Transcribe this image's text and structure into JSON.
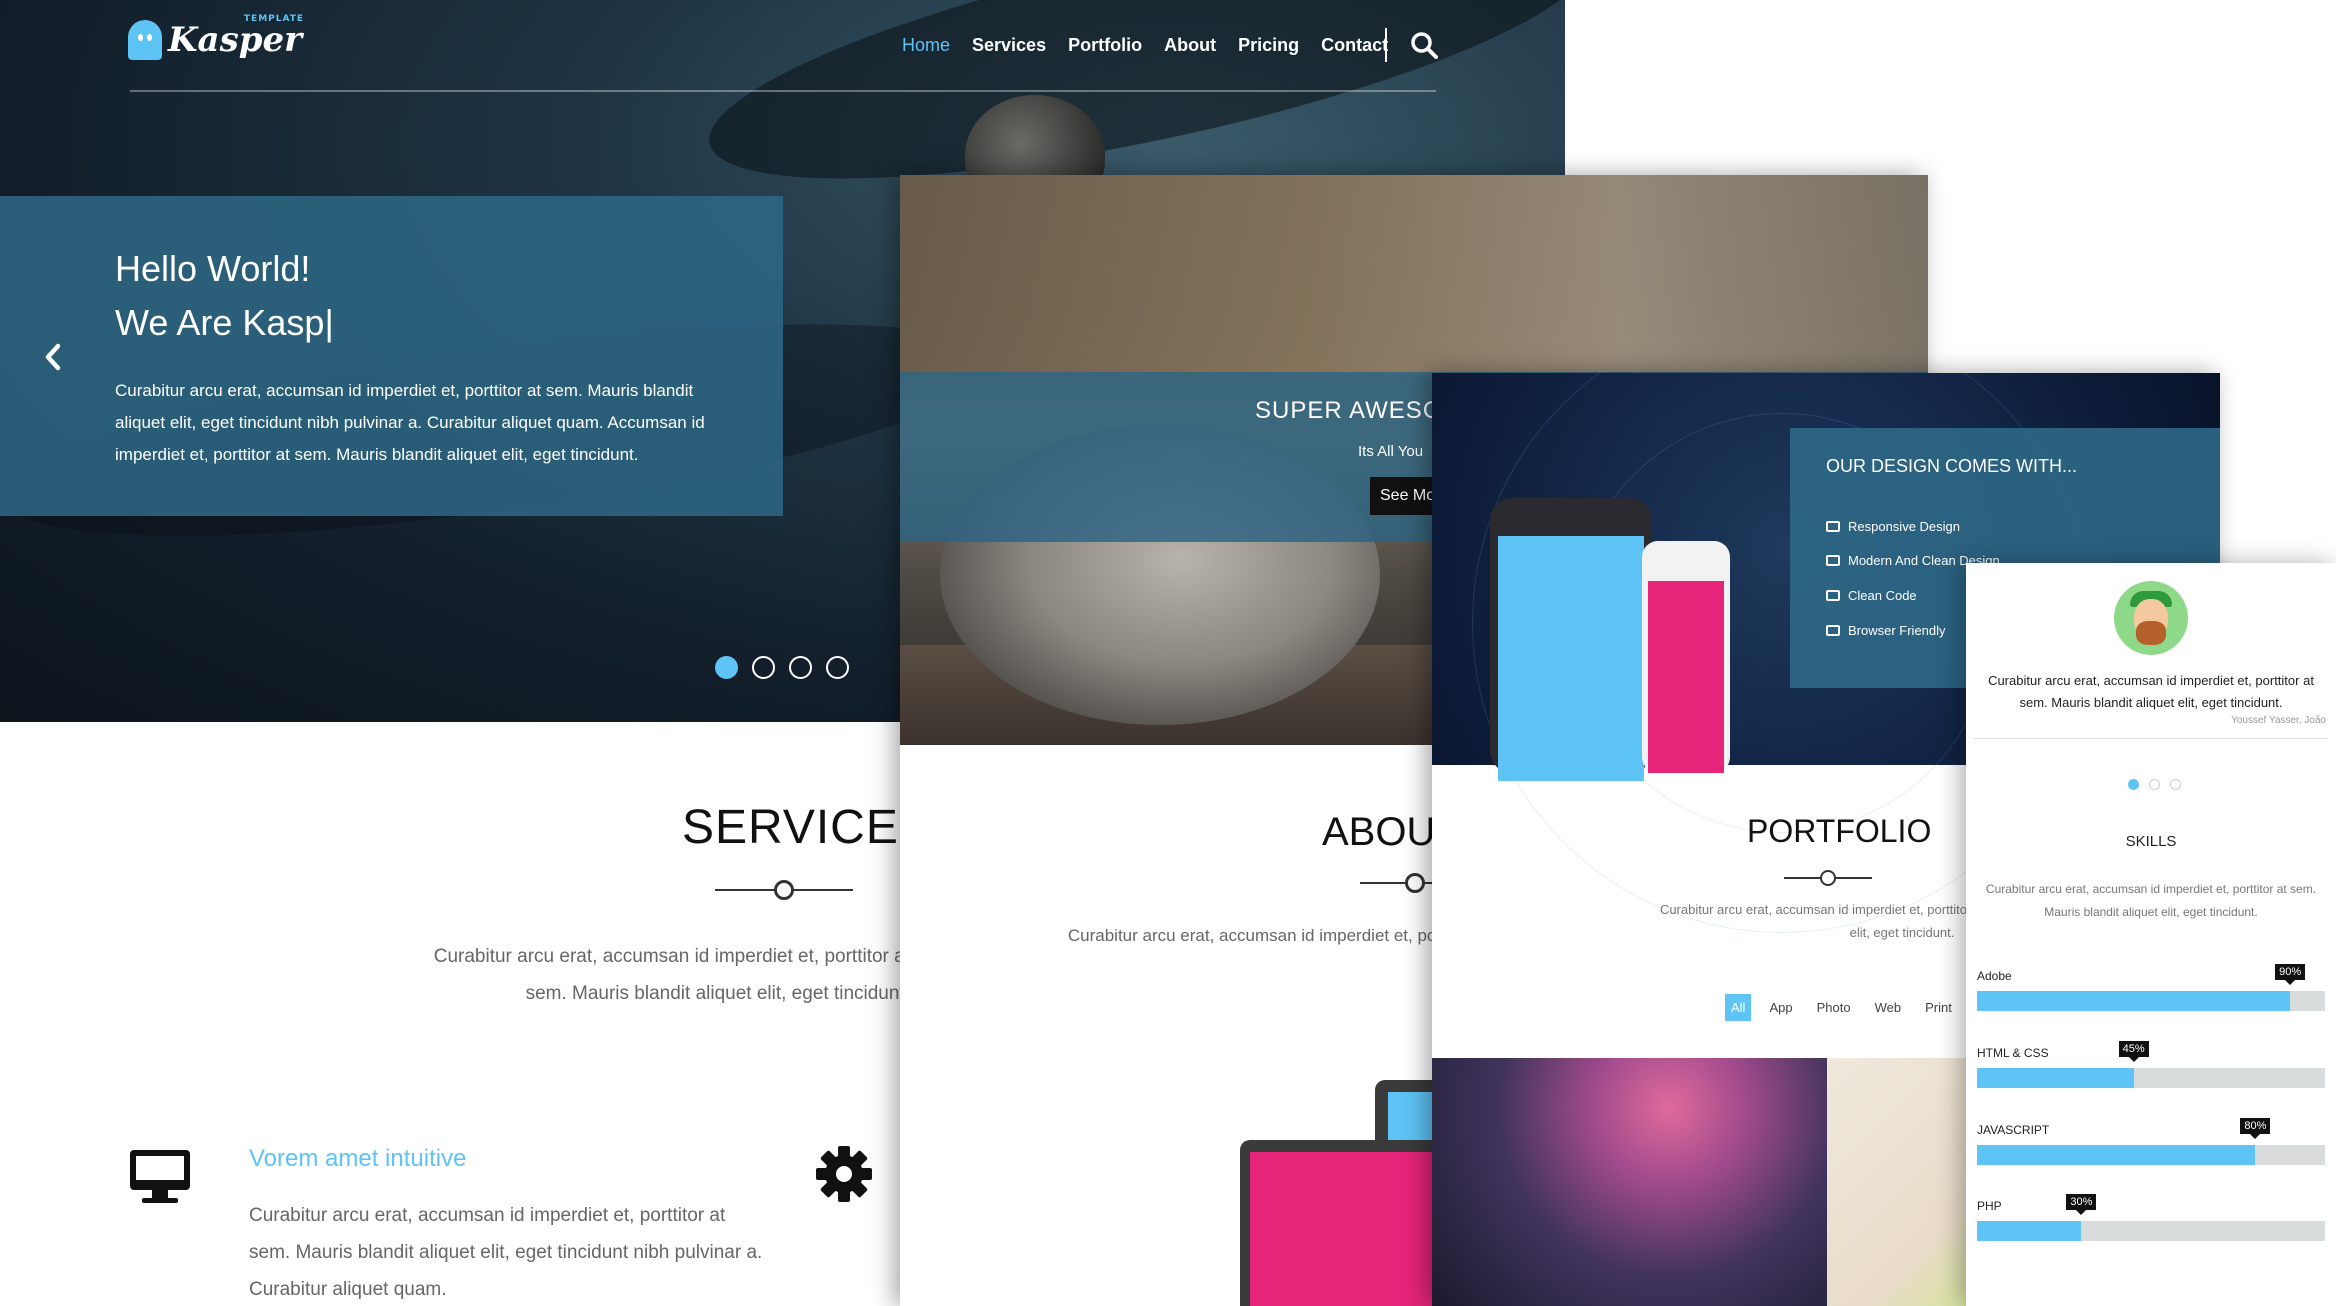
{
  "brand": {
    "logo_name": "Kasper",
    "logo_tag": "TEMPLATE",
    "accent": "#5ec3f5",
    "highlight": "#e5247a"
  },
  "nav": {
    "items": [
      "Home",
      "Services",
      "Portfolio",
      "About",
      "Pricing",
      "Contact"
    ],
    "active": "Home"
  },
  "hero": {
    "line1": "Hello World!",
    "line2": "We Are Kasp|",
    "text": "Curabitur arcu erat, accumsan id imperdiet et, porttitor at sem. Mauris blandit aliquet elit, eget tincidunt nibh pulvinar a. Curabitur aliquet quam. Accumsan id imperdiet et, porttitor at sem. Mauris blandit aliquet elit, eget tincidunt.",
    "slide_count": 4,
    "active_slide": 1
  },
  "services": {
    "title": "SERVICES",
    "text": "Curabitur arcu erat, accumsan id imperdiet et, porttitor at sem. Mauris blandit aliquet elit, eget tincidunt.",
    "feature_title": "Vorem amet intuitive",
    "feature_text": "Curabitur arcu erat, accumsan id imperdiet et, porttitor at sem. Mauris blandit aliquet elit, eget tincidunt nibh pulvinar a. Curabitur aliquet quam."
  },
  "awesome": {
    "heading": "SUPER AWESOME",
    "subheading": "Its All You",
    "button": "See More"
  },
  "about": {
    "title": "ABOUT",
    "text": "Curabitur arcu erat, accumsan id imperdiet et, porttitor at sem. Mauris blandit aliquet elit."
  },
  "design": {
    "heading": "OUR DESIGN COMES WITH...",
    "features": [
      "Responsive Design",
      "Modern And Clean Design",
      "Clean Code",
      "Browser Friendly"
    ]
  },
  "portfolio": {
    "title": "PORTFOLIO",
    "text": "Curabitur arcu erat, accumsan id imperdiet et, porttitor at sem. Mauris blandit aliquet elit, eget tincidunt.",
    "filters": [
      "All",
      "App",
      "Photo",
      "Web",
      "Print"
    ],
    "active_filter": "All"
  },
  "testimonial": {
    "quote": "Curabitur arcu erat, accumsan id imperdiet et, porttitor at sem. Mauris blandit aliquet elit, eget tincidunt.",
    "author": "Youssef Yasser, João",
    "dot_count": 3,
    "active_dot": 1
  },
  "skills": {
    "title": "SKILLS",
    "text": "Curabitur arcu erat, accumsan id imperdiet et, porttitor at sem. Mauris blandit aliquet elit, eget tincidunt.",
    "items": [
      {
        "name": "Adobe",
        "percent": 90,
        "label": "90%"
      },
      {
        "name": "HTML & CSS",
        "percent": 45,
        "label": "45%"
      },
      {
        "name": "JAVASCRIPT",
        "percent": 80,
        "label": "80%"
      },
      {
        "name": "PHP",
        "percent": 30,
        "label": "30%"
      }
    ]
  }
}
